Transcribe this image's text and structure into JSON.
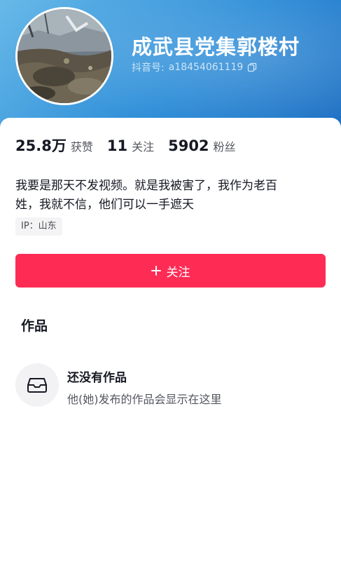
{
  "profile": {
    "nickname": "成武县党集郭楼村",
    "account_label": "抖音号:",
    "account_id": "a18454061119",
    "avatar_icon": "avatar-photo",
    "copy_icon": "copy-icon"
  },
  "stats": [
    {
      "value": "25.8万",
      "label": "获赞"
    },
    {
      "value": "11",
      "label": "关注"
    },
    {
      "value": "5902",
      "label": "粉丝"
    }
  ],
  "bio": {
    "line1": "我要是那天不发视频。就是我被害了，我作为老百",
    "line2": "姓，我就不信，他们可以一手遮天"
  },
  "ip": "IP：山东",
  "follow_button": {
    "label": "关注",
    "icon": "plus-icon"
  },
  "works": {
    "title": "作品",
    "empty_icon": "inbox-tray-icon",
    "empty_title": "还没有作品",
    "empty_desc": "他(她)发布的作品会显示在这里"
  },
  "colors": {
    "accent": "#fe2c55",
    "header_blue": "#2f8ed8"
  }
}
